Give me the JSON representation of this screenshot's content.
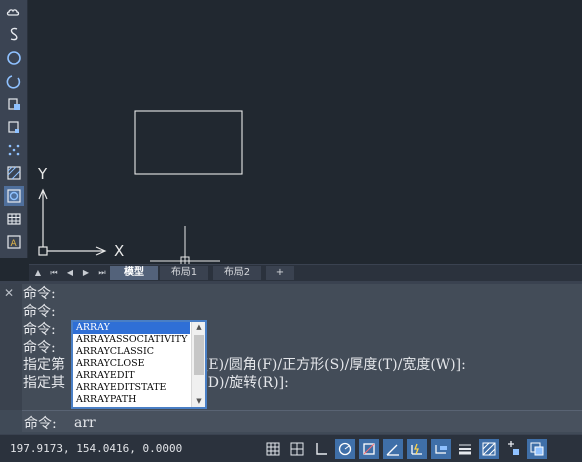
{
  "canvas": {
    "axis_y_label": "Y",
    "axis_x_label": "X"
  },
  "tabs": {
    "items": [
      {
        "label": "模型",
        "active": true
      },
      {
        "label": "布局1",
        "active": false
      },
      {
        "label": "布局2",
        "active": false
      },
      {
        "label": "+",
        "active": false
      }
    ]
  },
  "command": {
    "history": [
      "命令:",
      "命令:",
      "命令:",
      "命令:",
      "指定第                    C)/标高(E)/圆角(F)/正方形(S)/厚度(T)/宽度(W)]:",
      "指定其                    A)/尺寸(D)/旋转(R)]:"
    ],
    "prompt": "命令:",
    "input_value": "arr"
  },
  "autocomplete": {
    "items": [
      "ARRAY",
      "ARRAYASSOCIATIVITY",
      "ARRAYCLASSIC",
      "ARRAYCLOSE",
      "ARRAYEDIT",
      "ARRAYEDITSTATE",
      "ARRAYPATH"
    ],
    "selected": "ARRAY"
  },
  "status": {
    "coordinates": "197.9173, 154.0416, 0.0000"
  },
  "colors": {
    "accent": "#2f6fd6",
    "toolbar_icon": "#8fc1ff"
  }
}
